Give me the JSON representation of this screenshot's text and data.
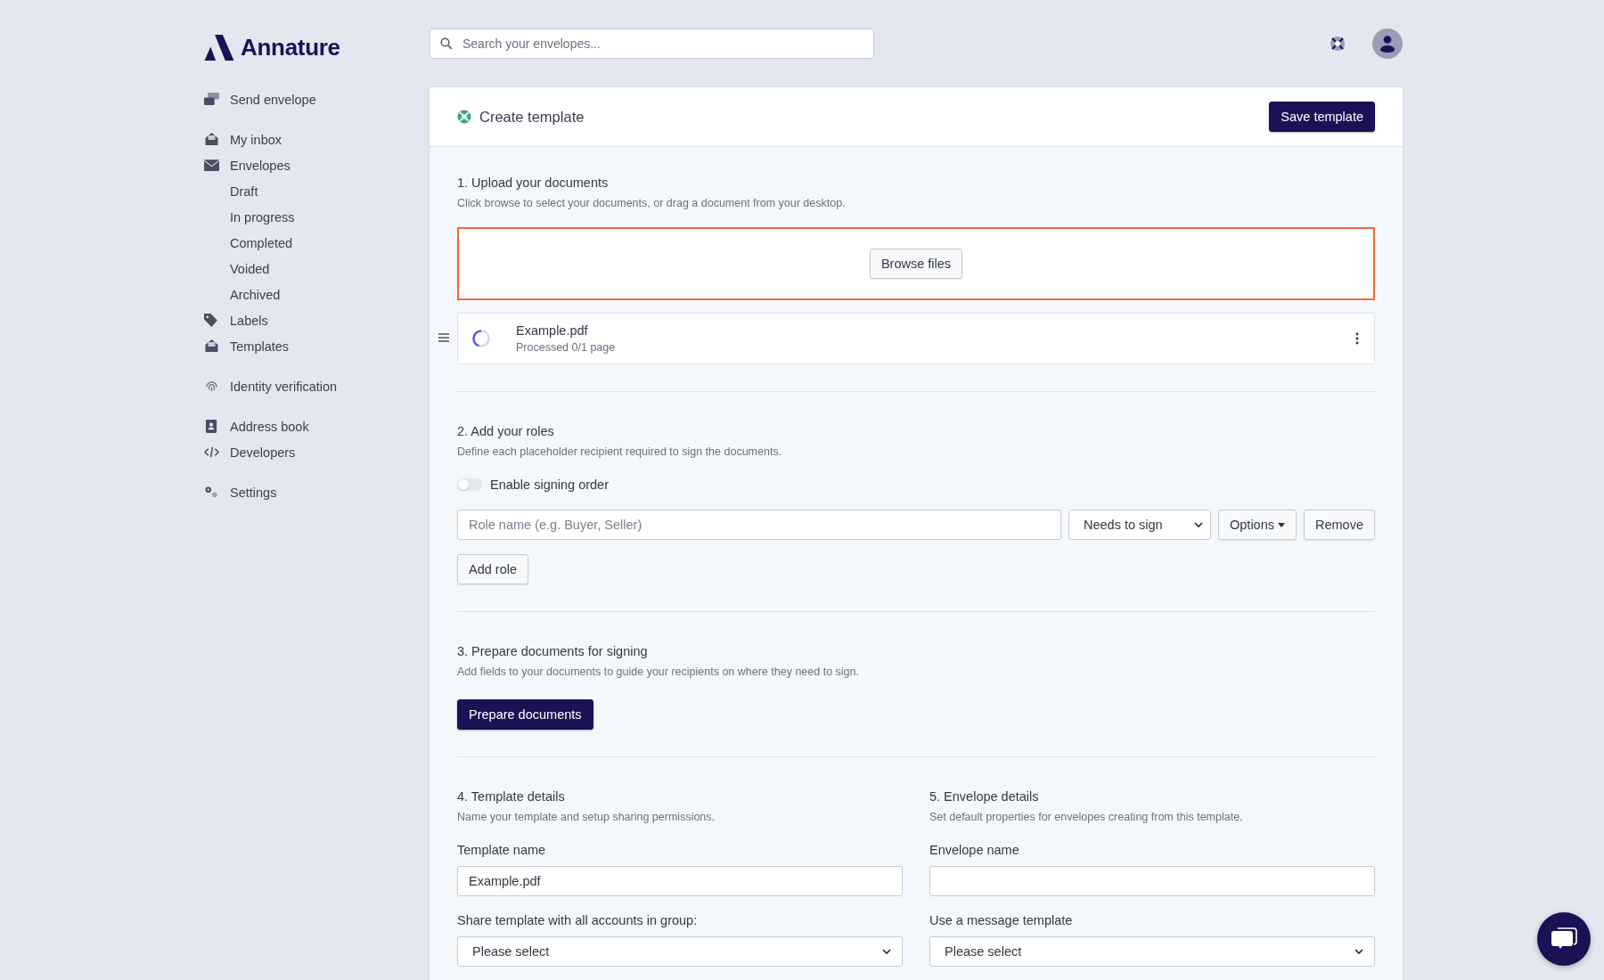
{
  "brand": {
    "name": "Annature"
  },
  "search": {
    "placeholder": "Search your envelopes..."
  },
  "sidebar": {
    "groups": [
      {
        "items": [
          {
            "label": "Send envelope"
          }
        ]
      },
      {
        "items": [
          {
            "label": "My inbox"
          },
          {
            "label": "Envelopes",
            "children": [
              {
                "label": "Draft"
              },
              {
                "label": "In progress"
              },
              {
                "label": "Completed"
              },
              {
                "label": "Voided"
              },
              {
                "label": "Archived"
              }
            ]
          },
          {
            "label": "Labels"
          },
          {
            "label": "Templates"
          }
        ]
      },
      {
        "items": [
          {
            "label": "Identity verification"
          }
        ]
      },
      {
        "items": [
          {
            "label": "Address book"
          },
          {
            "label": "Developers"
          }
        ]
      },
      {
        "items": [
          {
            "label": "Settings"
          }
        ]
      }
    ]
  },
  "panel": {
    "title": "Create template",
    "save_button": "Save template"
  },
  "upload": {
    "title": "1. Upload your documents",
    "description": "Click browse to select your documents, or drag a document from your desktop.",
    "browse_button": "Browse files",
    "files": [
      {
        "name": "Example.pdf",
        "status": "Processed 0/1 page"
      }
    ]
  },
  "roles": {
    "title": "2. Add your roles",
    "description": "Define each placeholder recipient required to sign the documents.",
    "signing_order": {
      "label": "Enable signing order",
      "on": false
    },
    "rows": [
      {
        "placeholder": "Role name (e.g. Buyer, Seller)",
        "action": "Needs to sign",
        "options_button": "Options",
        "remove_button": "Remove"
      }
    ],
    "add_button": "Add role"
  },
  "prepare": {
    "title": "3. Prepare documents for signing",
    "description": "Add fields to your documents to guide your recipients on where they need to sign.",
    "button": "Prepare documents"
  },
  "details": [
    {
      "title": "4. Template details",
      "description": "Name your template and setup sharing permissions.",
      "fields": [
        {
          "kind": "input",
          "label": "Template name",
          "value": "Example.pdf"
        },
        {
          "kind": "select",
          "label": "Share template with all accounts in group:",
          "value": "Please select"
        }
      ]
    },
    {
      "title": "5. Envelope details",
      "description": "Set default properties for envelopes creating from this template.",
      "fields": [
        {
          "kind": "input",
          "label": "Envelope name"
        },
        {
          "kind": "select",
          "label": "Use a message template",
          "value": "Please select"
        }
      ]
    }
  ]
}
